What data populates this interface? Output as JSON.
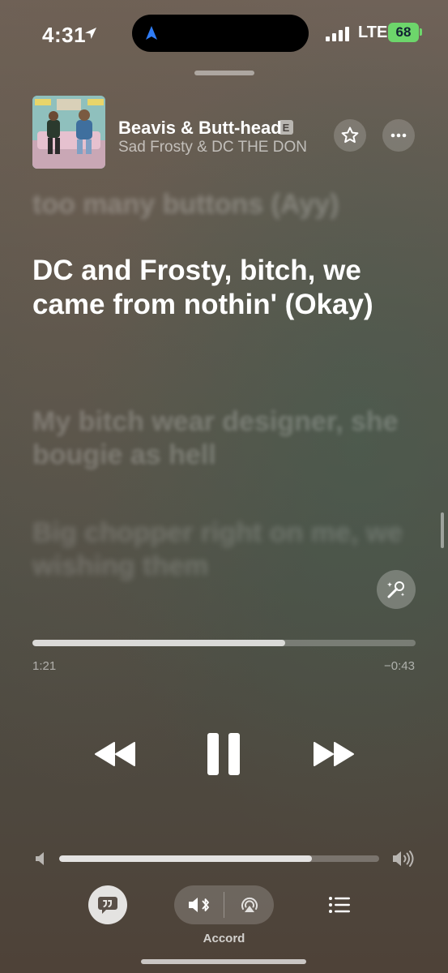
{
  "status_bar": {
    "time": "4:31",
    "network": "LTE",
    "battery": "68"
  },
  "now_playing": {
    "title": "Beavis & Butt-head",
    "explicit_badge": "E",
    "artist": "Sad Frosty & DC THE DON",
    "artwork_icon": "album-artwork"
  },
  "lyrics": {
    "previous": "too many buttons (Ayy)",
    "current": "DC and Frosty, bitch, we came from nothin' (Okay)",
    "next": "My bitch wear designer, she bougie as hell",
    "next2": "Big chopper right on me, we wishing them"
  },
  "progress": {
    "elapsed": "1:21",
    "remaining": "−0:43",
    "fraction": 0.66
  },
  "controls": {
    "rewind_icon": "rewind-icon",
    "pause_icon": "pause-icon",
    "forward_icon": "fast-forward-icon"
  },
  "volume": {
    "level": 0.79
  },
  "bottom_bar": {
    "lyrics_icon": "lyrics-quote-icon",
    "output_label": "Accord",
    "queue_icon": "queue-list-icon"
  },
  "colors": {
    "battery": "#6dd66b",
    "island": "#000000",
    "nav_arrow": "#2f7cf6"
  }
}
